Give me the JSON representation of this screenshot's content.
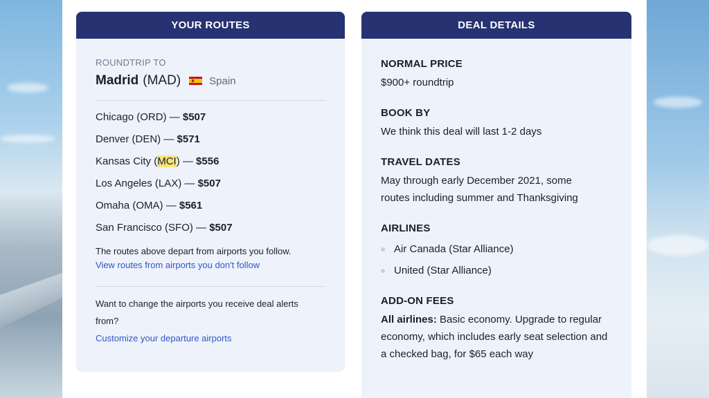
{
  "routes_card": {
    "header": "YOUR ROUTES",
    "eyebrow": "ROUNDTRIP TO",
    "destination_city": "Madrid",
    "destination_code": "(MAD)",
    "destination_country": "Spain",
    "flag_icon": "spain-flag-icon",
    "routes": [
      {
        "city": "Chicago (ORD)",
        "sep": " — ",
        "price": "$507"
      },
      {
        "city": "Denver (DEN)",
        "sep": " — ",
        "price": "$571"
      },
      {
        "city_prefix": "Kansas City (",
        "city_highlight": "MCI",
        "city_suffix": ")",
        "sep": " — ",
        "price": "$556"
      },
      {
        "city": "Los Angeles (LAX)",
        "sep": " — ",
        "price": "$507"
      },
      {
        "city": "Omaha (OMA)",
        "sep": " — ",
        "price": "$561"
      },
      {
        "city": "San Francisco (SFO)",
        "sep": " — ",
        "price": "$507"
      }
    ],
    "follow_note": "The routes above depart from airports you follow.",
    "follow_link": "View routes from airports you don't follow",
    "change_prompt": "Want to change the airports you receive deal alerts from?",
    "change_link": "Customize your departure airports"
  },
  "deal_card": {
    "header": "DEAL DETAILS",
    "normal_price_title": "NORMAL PRICE",
    "normal_price_text": "$900+ roundtrip",
    "book_by_title": "BOOK BY",
    "book_by_text": "We think this deal will last 1-2 days",
    "travel_dates_title": "TRAVEL DATES",
    "travel_dates_text": "May through early December 2021, some routes including summer and Thanksgiving",
    "airlines_title": "AIRLINES",
    "airlines": [
      "Air Canada (Star Alliance)",
      "United (Star Alliance)"
    ],
    "addon_title": "ADD-ON FEES",
    "addon_lead": "All airlines:",
    "addon_text": " Basic economy. Upgrade to regular economy, which includes early seat selection and a checked bag, for $65 each way"
  },
  "colors": {
    "header_bg": "#263271",
    "card_bg": "#eef2fb",
    "link": "#2f57c7",
    "highlight": "#f8e27a"
  }
}
